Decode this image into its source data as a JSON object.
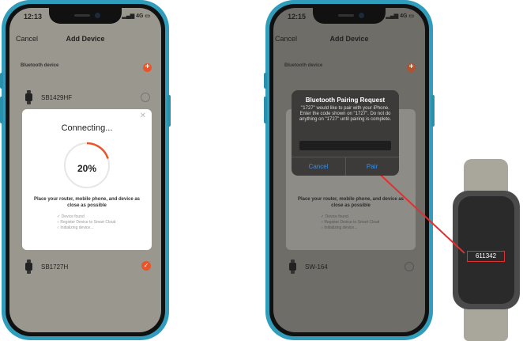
{
  "left_phone": {
    "status": {
      "time": "12:13",
      "signal": "4G"
    },
    "nav": {
      "cancel": "Cancel",
      "title": "Add Device"
    },
    "section_label": "Bluetooth device",
    "devices": [
      {
        "name": "SB1429HF",
        "selected": false
      },
      {
        "name": "SB1727H",
        "selected": true
      }
    ],
    "modal": {
      "title": "Connecting...",
      "progress": 20,
      "progress_label": "20%",
      "instruction": "Place your router, mobile phone, and device as close as possible",
      "steps": [
        "✓ Device found",
        "○ Register Device to Smart Cloud",
        "○ Initializing device..."
      ]
    }
  },
  "right_phone": {
    "status": {
      "time": "12:15",
      "signal": "4G"
    },
    "nav": {
      "cancel": "Cancel",
      "title": "Add Device"
    },
    "section_label": "Bluetooth device",
    "devices": [
      {
        "name": "SW-164"
      }
    ],
    "dialog": {
      "title": "Bluetooth Pairing Request",
      "message": "\"1727\" would like to pair with your iPhone. Enter the code shown on \"1727\". Do not do anything on \"1727\" until pairing is complete.",
      "cancel": "Cancel",
      "pair": "Pair"
    },
    "background": {
      "instruction": "Place your router, mobile phone, and device as close as possible",
      "steps": [
        "✓ Device found",
        "○ Register Device to Smart Cloud",
        "○ Initializing device..."
      ]
    }
  },
  "watch": {
    "code": "611342"
  },
  "colors": {
    "accent": "#e8552a",
    "phone_frame": "#2f9dbb",
    "arrow": "#e03030",
    "ios_blue": "#3b8ede"
  }
}
